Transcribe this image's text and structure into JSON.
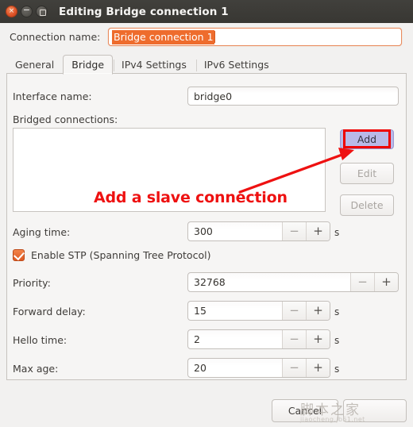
{
  "window": {
    "title": "Editing Bridge connection 1",
    "controls": [
      {
        "name": "close",
        "glyph": "×"
      },
      {
        "name": "minimize",
        "glyph": "−"
      },
      {
        "name": "maximize",
        "glyph": ""
      }
    ]
  },
  "connection": {
    "label": "Connection name:",
    "value": "Bridge connection 1",
    "placeholder": "Connection name"
  },
  "tabs": [
    {
      "label": "General",
      "active": false
    },
    {
      "label": "Bridge",
      "active": true
    },
    {
      "label": "IPv4 Settings",
      "active": false
    },
    {
      "label": "IPv6 Settings",
      "active": false
    }
  ],
  "bridge": {
    "interface_name": {
      "label": "Interface name:",
      "value": "bridge0"
    },
    "bridged_connections": {
      "label": "Bridged connections:",
      "items": []
    },
    "list_buttons": [
      {
        "label": "Add",
        "state": "selected"
      },
      {
        "label": "Edit",
        "state": "disabled"
      },
      {
        "label": "Delete",
        "state": "disabled"
      }
    ],
    "aging_time": {
      "label": "Aging time:",
      "value": "300",
      "unit": "s",
      "minus": "−",
      "plus": "+"
    },
    "stp": {
      "label": "Enable STP (Spanning Tree Protocol)",
      "checked": true
    },
    "priority": {
      "label": "Priority:",
      "value": "32768",
      "unit": "",
      "minus": "−",
      "plus": "+"
    },
    "forward_delay": {
      "label": "Forward delay:",
      "value": "15",
      "unit": "s",
      "minus": "−",
      "plus": "+"
    },
    "hello_time": {
      "label": "Hello time:",
      "value": "2",
      "unit": "s",
      "minus": "−",
      "plus": "+"
    },
    "max_age": {
      "label": "Max age:",
      "value": "20",
      "unit": "s",
      "minus": "−",
      "plus": "+"
    }
  },
  "footer": {
    "cancel_label": "Cancel",
    "save_label": ""
  },
  "annotation": {
    "text": "Add a slave connection",
    "color": "#ee1111"
  },
  "watermark": {
    "text": "脚本之家",
    "url": "jiaocheng.jb51.net"
  },
  "colors": {
    "titlebar": "#3c3b37",
    "accent_orange": "#ee6c2d",
    "selected_button": "#b9b9e8",
    "annotation_red": "#ee1111",
    "window_bg": "#f2f1f0"
  }
}
